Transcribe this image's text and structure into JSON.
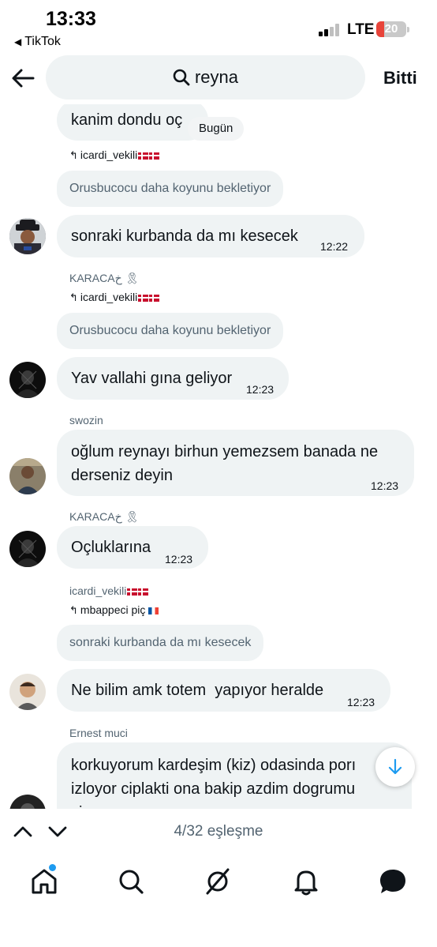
{
  "status_bar": {
    "time": "13:33",
    "back_app": "TikTok",
    "network": "LTE",
    "battery": "20"
  },
  "header": {
    "search_query": "reyna",
    "done_label": "Bitti",
    "back_icon": "arrow-left-icon"
  },
  "chat": {
    "date_pill": "Bugün",
    "messages": [
      {
        "text": "kanim dondu oç"
      },
      {
        "reply_to": "icardi_vekili",
        "quote": "Orusbucocu daha koyunu bekletiyor"
      },
      {
        "text": "sonraki kurbanda da mı kesecek",
        "time": "12:22"
      },
      {
        "sender": "KARACA",
        "sender_suffix": "خ 🎗",
        "reply_to": "icardi_vekili",
        "quote": "Orusbucocu daha koyunu bekletiyor"
      },
      {
        "text": "Yav vallahi gına geliyor",
        "time": "12:23"
      },
      {
        "sender": "swozin"
      },
      {
        "text_line1": "oğlum reynayı birhun yemezsem banada ne",
        "text_line2": "derseniz deyin",
        "time": "12:23"
      },
      {
        "sender": "KARACA",
        "sender_suffix": "خ 🎗"
      },
      {
        "text": "Oçluklarına",
        "time": "12:23"
      },
      {
        "sender": "icardi_vekili",
        "reply_to": "mbappeci piç",
        "quote": "sonraki kurbanda da mı kesecek"
      },
      {
        "text": "Ne bilim amk totem  yapıyor heralde",
        "time": "12:23"
      },
      {
        "sender": "Ernest muci"
      },
      {
        "text_line1": "korkuyorum kardeşim (kiz) odasinda porı",
        "text_line2": "izloyor ciplakti ona bakip azdim dogrumu",
        "text_line3": "sizce"
      }
    ]
  },
  "match_bar": {
    "count": "4/32 eşleşme"
  },
  "bottom_nav": {
    "items": [
      "home-icon",
      "search-icon",
      "grok-icon",
      "notifications-icon",
      "messages-icon"
    ],
    "active": "home-icon",
    "badge_color": "#1d9bf0"
  },
  "colors": {
    "bubble": "#eff3f4",
    "muted_text": "#536471",
    "accent": "#1d9bf0"
  }
}
